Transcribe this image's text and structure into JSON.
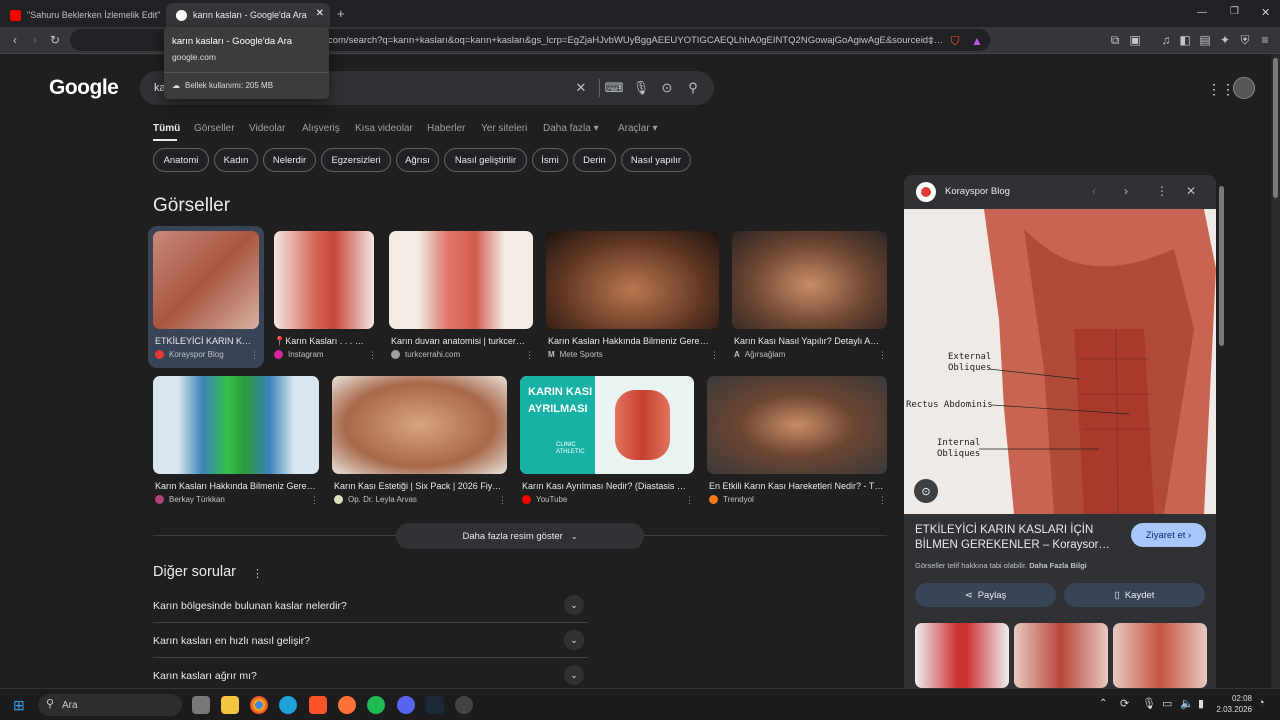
{
  "tabs": [
    {
      "title": "\"Sahuru Beklerken İzlemelik Edit\" Kız…"
    },
    {
      "title": "karın kasları - Google'da Ara"
    }
  ],
  "new_tab_label": "+",
  "url": "com/search?q=karın+kasları&oq=karın+kasları&gs_lcrp=EgZjaHJvbWUyBggAEEUYOTIGCAEQLhhA0gEINTQ2NGowajGoAgiwAgE&sourceid=…",
  "tooltip": {
    "title": "karın kasları - Google'da Ara",
    "domain": "google.com",
    "memory": "Bellek kullanımı: 205 MB"
  },
  "logo": "Google",
  "search": {
    "query": "ka"
  },
  "nav": [
    "Tümü",
    "Görseller",
    "Videolar",
    "Alışveriş",
    "Kısa videolar",
    "Haberler",
    "Yer siteleri",
    "Daha fazla ▾",
    "Araçlar ▾"
  ],
  "chips": [
    "Anatomi",
    "Kadın",
    "Nelerdir",
    "Egzersizleri",
    "Ağrısı",
    "Nasıl geliştirilir",
    "İsmi",
    "Derin",
    "Nasıl yapılır"
  ],
  "images_title": "Görseller",
  "images": [
    {
      "caption": "ETKİLEYİCİ KARIN KAS…",
      "source": "Korayspor Blog"
    },
    {
      "caption": "📍Karın Kasları . . . . . .",
      "source": "Instagram"
    },
    {
      "caption": "Karın duvarı anatomisi | turkcer…",
      "source": "turkcerrahi.com"
    },
    {
      "caption": "Karın Kasları Hakkında Bilmeniz Gerek…",
      "source": "Mete Sports"
    },
    {
      "caption": "Karın Kası Nasıl Yapılır? Detaylı An…",
      "source": "Ağırsağlam"
    },
    {
      "caption": "Karın Kasları Hakkında Bilmeniz Gere…",
      "source": "Berkay Türkkan"
    },
    {
      "caption": "Karın Kası Estetiği | Six Pack | 2026 Fiy…",
      "source": "Op. Dr. Leyla Arvas"
    },
    {
      "caption": "Karın Kası Ayrılması Nedir? (Diastasis R…",
      "source": "YouTube"
    },
    {
      "caption": "En Etkili Karın Kası Hareketleri Nedir? - T…",
      "source": "Trendyol"
    }
  ],
  "more_images": "Daha fazla resim göster",
  "paa_title": "Diğer sorular",
  "questions": [
    "Karın bölgesinde bulunan kaslar nelerdir?",
    "Karın kasları en hızlı nasıl gelişir?",
    "Karın kasları ağrır mı?"
  ],
  "panel": {
    "site": "Korayspor Blog",
    "heading": "ETKİLEYİCİ KARIN KASLARI İÇİN BİLMEN GEREKENLER – Koraysor…",
    "visit": "Ziyaret et ›",
    "note_prefix": "Görseller telif hakkına tabi olabilir.",
    "note_link": "Daha Fazla Bilgi",
    "share": "Paylaş",
    "save": "Kaydet",
    "img_labels": [
      "External",
      "Obliques",
      "Rectus Abdominis",
      "Internal",
      "Obliques"
    ]
  },
  "taskbar": {
    "search": "Ara",
    "time": "02:08",
    "date": "2.03.2026"
  },
  "thumb_text": [
    "KARIN KASI",
    "AYRILMASI",
    "CLINIC",
    "ATHLETIC"
  ]
}
